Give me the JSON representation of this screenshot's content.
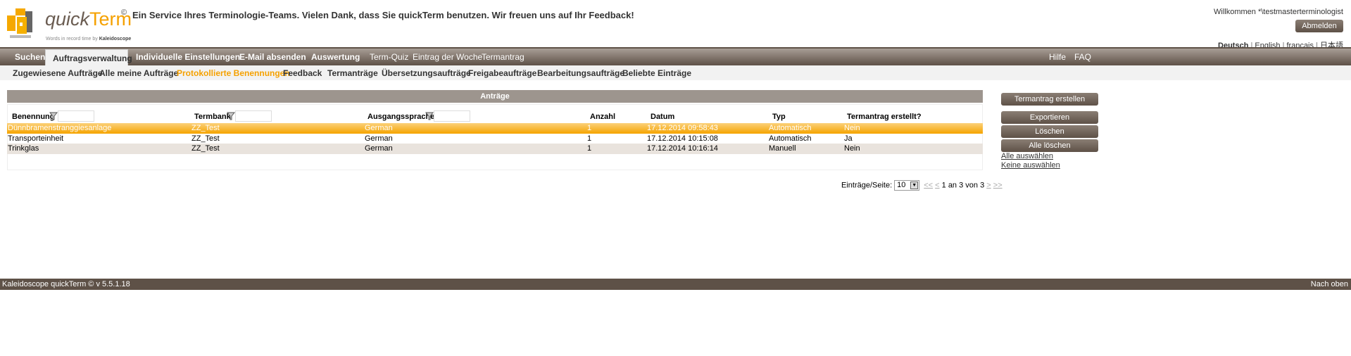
{
  "header": {
    "brand_italic": "quick",
    "brand_main": "Term",
    "tagline": "Words in record time by",
    "tagline_brand": "Kaleidoscope",
    "copyright": "©",
    "service_text": "Ein Service Ihres Terminologie-Teams. Vielen Dank, dass Sie quickTerm benutzen. Wir freuen uns auf Ihr Feedback!",
    "welcome": "Willkommen *\\testmasterterminologist",
    "logout": "Abmelden",
    "languages": [
      "Deutsch",
      "English",
      "français",
      "日本語"
    ]
  },
  "nav": {
    "items": [
      "Suchen",
      "Auftragsverwaltung",
      "Individuelle Einstellungen",
      "E-Mail absenden",
      "Auswertung",
      "Term-Quiz",
      "Eintrag der Woche",
      "Termantrag"
    ],
    "active": "Auftragsverwaltung",
    "right": [
      "Hilfe",
      "FAQ"
    ]
  },
  "subnav": {
    "items": [
      "Zugewiesene Aufträge",
      "Alle meine Aufträge",
      "Protokollierte Benennungen",
      "Feedback",
      "Termanträge",
      "Übersetzungsaufträge",
      "Freigabeaufträge",
      "Bearbeitungsaufträge",
      "Beliebte Einträge"
    ],
    "active": "Protokollierte Benennungen"
  },
  "panel": {
    "title": "Anträge",
    "columns": [
      "Benennung",
      "Termbank",
      "Ausgangssprache",
      "Anzahl",
      "Datum",
      "Typ",
      "Termantrag erstellt?"
    ],
    "rows": [
      [
        "Dünnbramenstranggiesanlage",
        "ZZ_Test",
        "German",
        "1",
        "17.12.2014 09:58:43",
        "Automatisch",
        "Nein"
      ],
      [
        "Transporteinheit",
        "ZZ_Test",
        "German",
        "1",
        "17.12.2014 10:15:08",
        "Automatisch",
        "Ja"
      ],
      [
        "Trinkglas",
        "ZZ_Test",
        "German",
        "1",
        "17.12.2014 10:16:14",
        "Manuell",
        "Nein"
      ]
    ],
    "selected_row": 0
  },
  "pager": {
    "label": "Einträge/Seite:",
    "page_size": "10",
    "first": "<<",
    "prev": "<",
    "status": "1 an 3 von 3",
    "next": ">",
    "last": ">>"
  },
  "actions": {
    "create": "Termantrag erstellen",
    "export": "Exportieren",
    "delete": "Löschen",
    "delete_all": "Alle löschen",
    "select_all": "Alle auswählen",
    "select_none": "Keine auswählen"
  },
  "footer": {
    "left": "Kaleidoscope quickTerm © v 5.5.1.18",
    "right": "Nach oben"
  },
  "colors": {
    "accent": "#f5a100",
    "brown": "#5e5147",
    "panel_header": "#9d958e"
  }
}
